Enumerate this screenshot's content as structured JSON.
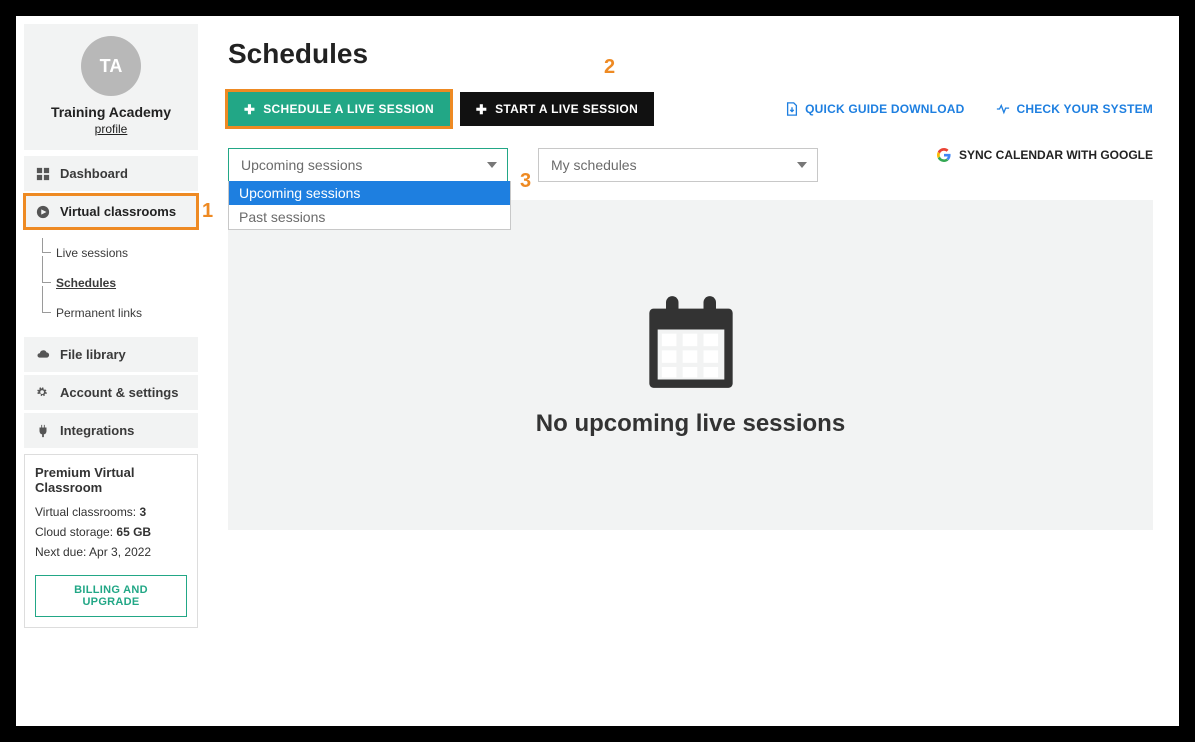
{
  "sidebar": {
    "avatar_initials": "TA",
    "org_name": "Training Academy",
    "profile_link": "profile",
    "nav": {
      "dashboard": "Dashboard",
      "virtual_classrooms": "Virtual classrooms",
      "file_library": "File library",
      "account_settings": "Account & settings",
      "integrations": "Integrations"
    },
    "vc_sub": {
      "live_sessions": "Live sessions",
      "schedules": "Schedules",
      "permanent_links": "Permanent links"
    },
    "plan": {
      "heading": "Premium Virtual Classroom",
      "rooms_label": "Virtual classrooms: ",
      "rooms_value": "3",
      "storage_label": "Cloud storage: ",
      "storage_value": "65 GB",
      "next_due_label": "Next due: ",
      "next_due_value": "Apr 3, 2022",
      "upgrade_button": "BILLING AND UPGRADE"
    }
  },
  "main": {
    "title": "Schedules",
    "buttons": {
      "schedule": "SCHEDULE A LIVE SESSION",
      "start": "START A LIVE SESSION"
    },
    "links": {
      "guide": "QUICK GUIDE DOWNLOAD",
      "check": "CHECK YOUR SYSTEM",
      "sync": "SYNC CALENDAR WITH GOOGLE"
    },
    "filters": {
      "sessions_selected": "Upcoming sessions",
      "sessions_options": {
        "upcoming": "Upcoming sessions",
        "past": "Past sessions"
      },
      "schedules_selected": "My schedules"
    },
    "empty_state": "No upcoming live sessions"
  },
  "annotations": {
    "one": "1",
    "two": "2",
    "three": "3"
  }
}
